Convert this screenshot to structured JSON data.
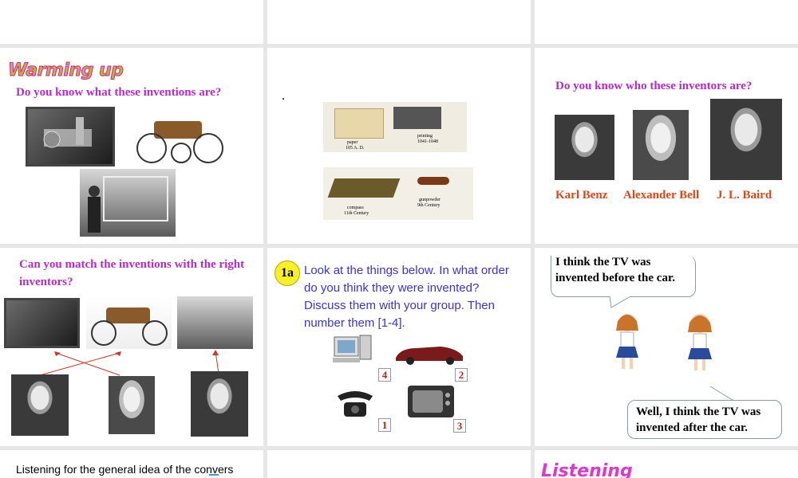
{
  "slide2": {
    "title_logo": "Warming up",
    "question": "Do you know what these inventions are?"
  },
  "slide3": {
    "dot": ".",
    "labels": {
      "paper": [
        "paper",
        "105 A. D."
      ],
      "printing": [
        "printing",
        "1041-1048"
      ],
      "compass": [
        "compass",
        "11th Century"
      ],
      "gunpowder": [
        "gunpowder",
        "9th Century"
      ]
    }
  },
  "slide4": {
    "question": "Do you know who these inventors are?",
    "names": [
      "Karl Benz",
      "Alexander Bell",
      "J. L. Baird"
    ]
  },
  "slide5": {
    "question": "Can you match the inventions with the right inventors?"
  },
  "slide6": {
    "badge": "1a",
    "instruction": "Look at the things below. In what order do you think they were invented? Discuss them with your group. Then number them [1-4].",
    "numbers": {
      "computer": "4",
      "car": "2",
      "phone": "1",
      "tv": "3"
    }
  },
  "slide7": {
    "bubble1": "I think the TV was invented before the car.",
    "bubble2": "Well, I think the TV was invented after the car."
  },
  "slide8": {
    "text": "Listening for the general idea of the convers"
  },
  "slide10": {
    "logo": "Listening"
  },
  "colors": {
    "magenta": "#b02ec4",
    "orange": "#d9481c",
    "blue_text": "#3b35c9",
    "number_red": "#c21c1c"
  }
}
